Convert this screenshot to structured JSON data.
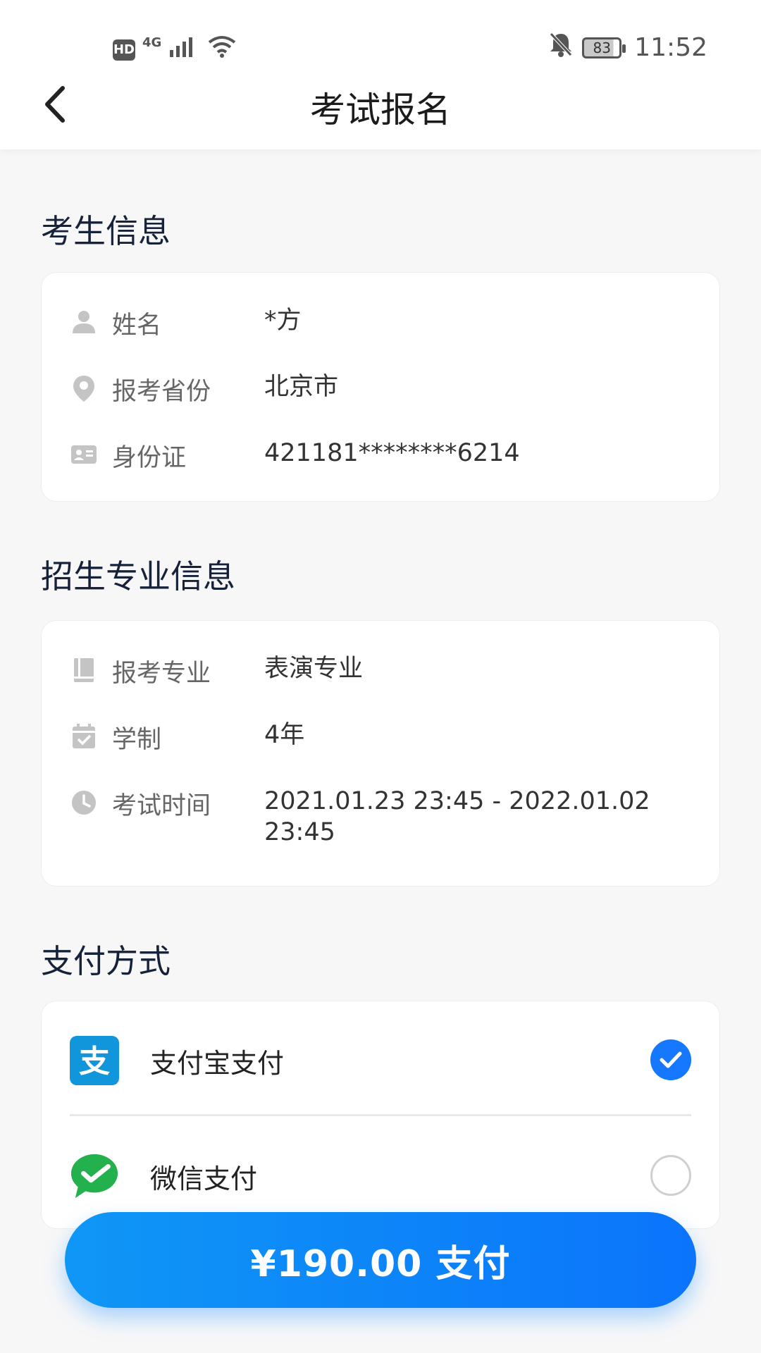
{
  "status_bar": {
    "hd": "HD",
    "network": "4G",
    "battery": "83",
    "time": "11:52"
  },
  "header": {
    "title": "考试报名"
  },
  "candidate": {
    "section_title": "考生信息",
    "rows": [
      {
        "icon": "person-icon",
        "label": "姓名",
        "value": "*方"
      },
      {
        "icon": "location-pin-icon",
        "label": "报考省份",
        "value": "北京市"
      },
      {
        "icon": "id-card-icon",
        "label": "身份证",
        "value": "421181********6214"
      }
    ]
  },
  "major": {
    "section_title": "招生专业信息",
    "rows": [
      {
        "icon": "book-icon",
        "label": "报考专业",
        "value": "表演专业"
      },
      {
        "icon": "calendar-check-icon",
        "label": "学制",
        "value": "4年"
      },
      {
        "icon": "clock-icon",
        "label": "考试时间",
        "value": "2021.01.23 23:45 - 2022.01.02 23:45"
      }
    ]
  },
  "payment": {
    "section_title": "支付方式",
    "methods": [
      {
        "icon": "alipay-icon",
        "label": "支付宝支付",
        "selected": true,
        "color": "#1296db"
      },
      {
        "icon": "wechat-pay-icon",
        "label": "微信支付",
        "selected": false,
        "color": "#22b14c"
      }
    ]
  },
  "pay_button": {
    "label": "¥190.00 支付"
  },
  "colors": {
    "accent": "#1677ff",
    "background": "#f7f7f8"
  }
}
